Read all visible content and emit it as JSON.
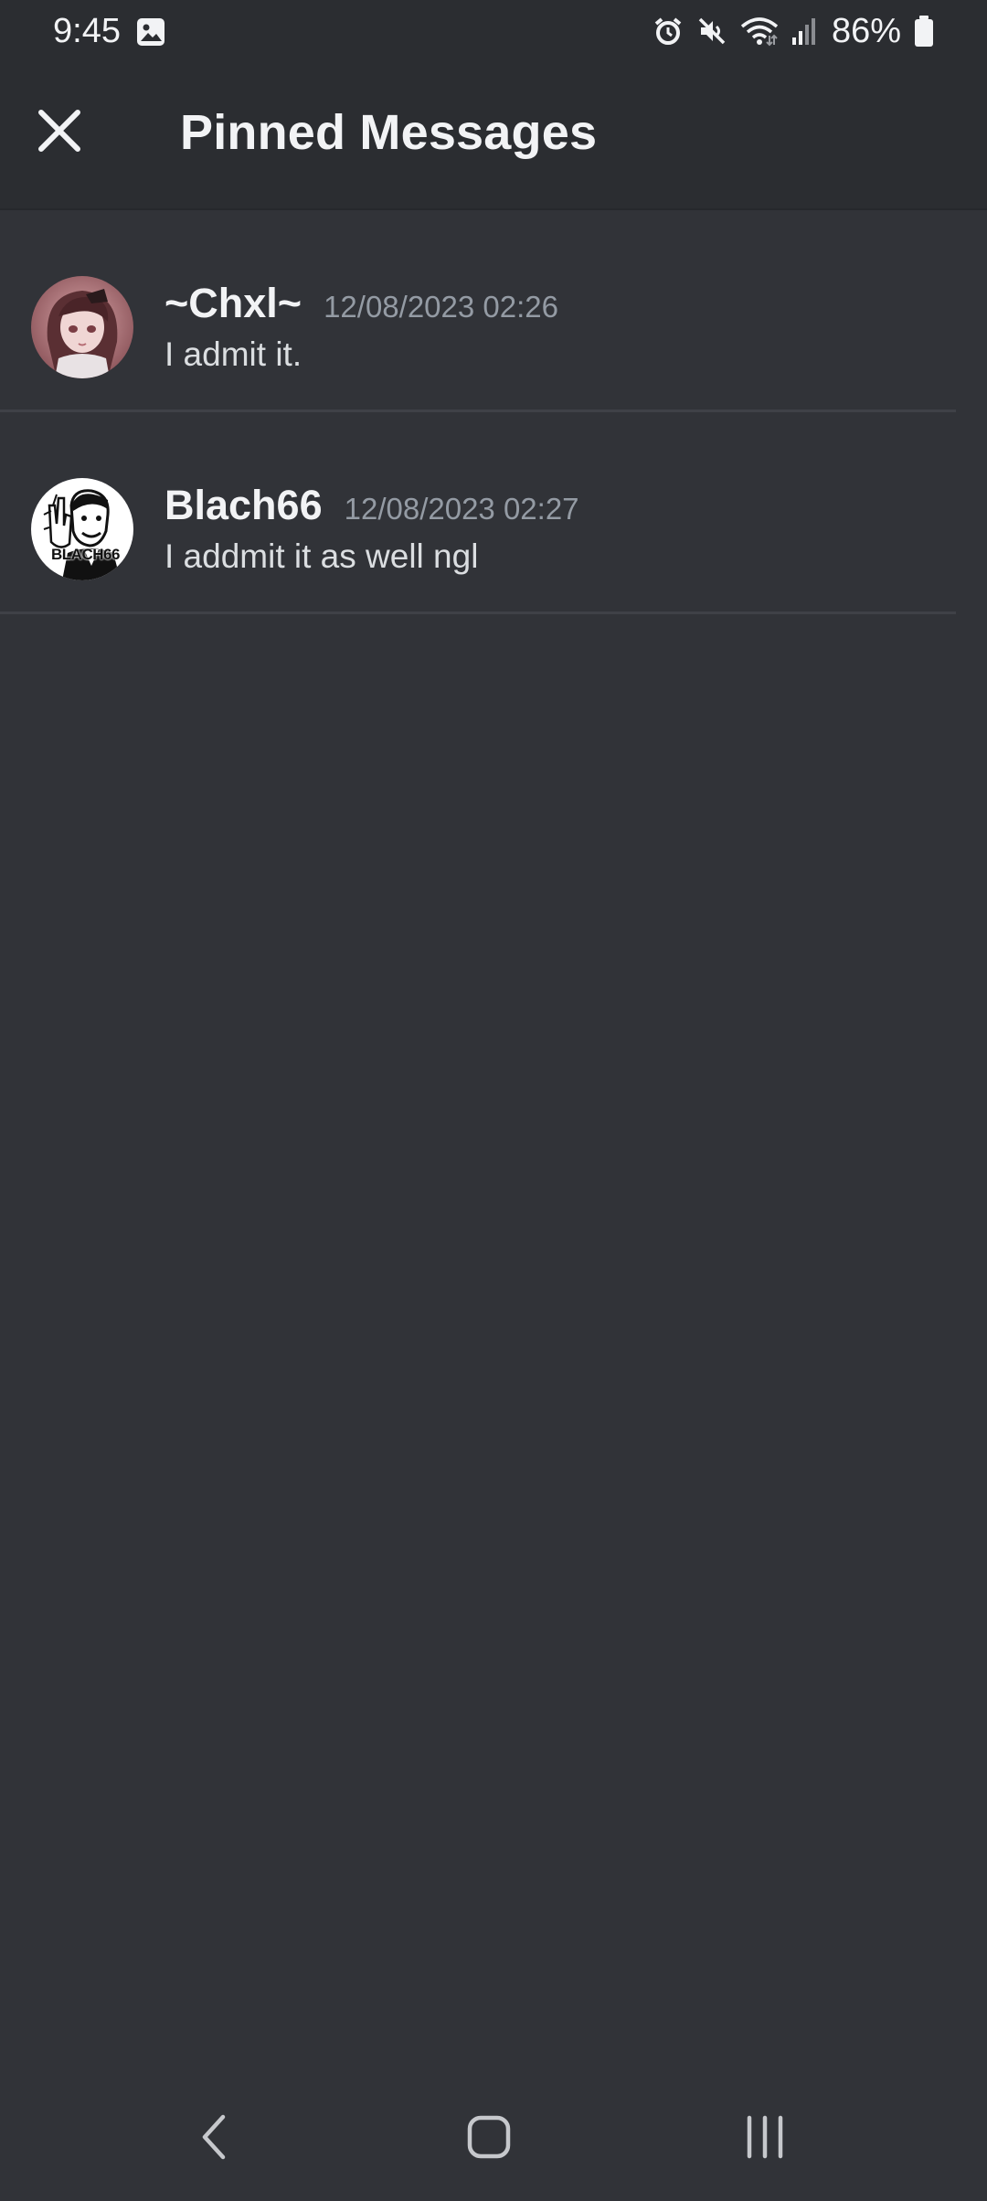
{
  "status_bar": {
    "time": "9:45",
    "battery": "86%",
    "icons": [
      "gallery-icon",
      "alarm-icon",
      "mute-icon",
      "wifi-icon",
      "signal-icon",
      "battery-icon"
    ]
  },
  "header": {
    "title": "Pinned Messages",
    "close_icon": "close-icon"
  },
  "pinned_messages": [
    {
      "author": "~Chxl~",
      "timestamp": "12/08/2023 02:26",
      "text": "I admit it."
    },
    {
      "author": "Blach66",
      "timestamp": "12/08/2023 02:27",
      "text": "I addmit it as well ngl",
      "avatar_text": "BLACH66"
    }
  ],
  "nav_bar": {
    "icons": [
      "back-icon",
      "home-icon",
      "recents-icon"
    ]
  },
  "colors": {
    "background": "#313338",
    "header_background": "#2b2d31",
    "text_primary": "#f2f3f5",
    "text_muted": "#949ba4",
    "divider": "#3f4147"
  }
}
